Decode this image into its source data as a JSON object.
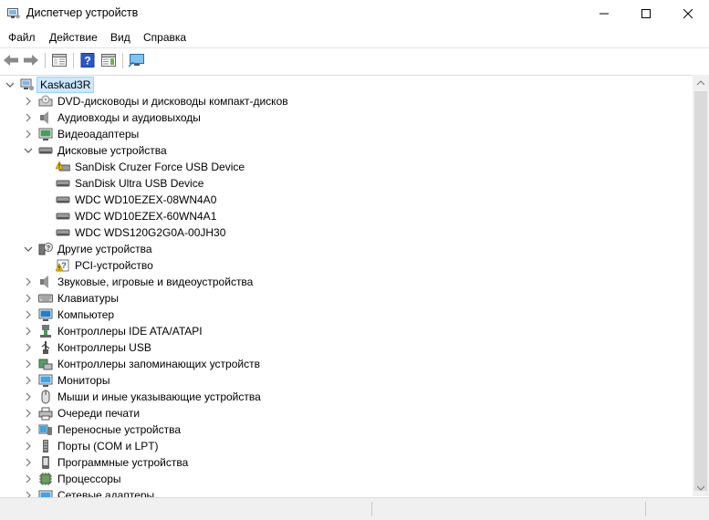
{
  "window": {
    "title": "Диспетчер устройств",
    "controls": [
      "minimize",
      "maximize",
      "close"
    ]
  },
  "menu": [
    "Файл",
    "Действие",
    "Вид",
    "Справка"
  ],
  "toolbar": [
    "back-icon",
    "forward-icon",
    "properties-panel-icon",
    "help-icon",
    "details-panel-icon",
    "monitor-scan-icon"
  ],
  "tree": {
    "root": "Kaskad3R",
    "rows": [
      {
        "label": "DVD-дисководы и дисководы компакт-дисков",
        "icon": "dvd-drive-icon"
      },
      {
        "label": "Аудиовходы и аудиовыходы",
        "icon": "speaker-icon"
      },
      {
        "label": "Видеоадаптеры",
        "icon": "display-adapter-icon"
      },
      {
        "label": "Дисковые устройства",
        "icon": "disk-drive-icon",
        "expanded": true
      },
      {
        "label": "SanDisk Cruzer Force USB Device",
        "icon": "disk-warning-icon",
        "child": true
      },
      {
        "label": "SanDisk Ultra USB Device",
        "icon": "disk-drive-icon",
        "child": true
      },
      {
        "label": "WDC WD10EZEX-08WN4A0",
        "icon": "disk-drive-icon",
        "child": true
      },
      {
        "label": "WDC WD10EZEX-60WN4A1",
        "icon": "disk-drive-icon",
        "child": true
      },
      {
        "label": "WDC WDS120G2G0A-00JH30",
        "icon": "disk-drive-icon",
        "child": true
      },
      {
        "label": "Другие устройства",
        "icon": "unknown-device-icon",
        "expanded": true
      },
      {
        "label": "PCI-устройство",
        "icon": "unknown-warning-icon",
        "child": true
      },
      {
        "label": "Звуковые, игровые и видеоустройства",
        "icon": "speaker-icon"
      },
      {
        "label": "Клавиатуры",
        "icon": "keyboard-icon"
      },
      {
        "label": "Компьютер",
        "icon": "computer-icon"
      },
      {
        "label": "Контроллеры IDE ATA/ATAPI",
        "icon": "ide-controller-icon"
      },
      {
        "label": "Контроллеры USB",
        "icon": "usb-icon"
      },
      {
        "label": "Контроллеры запоминающих устройств",
        "icon": "storage-controller-icon"
      },
      {
        "label": "Мониторы",
        "icon": "monitor-icon"
      },
      {
        "label": "Мыши и иные указывающие устройства",
        "icon": "mouse-icon"
      },
      {
        "label": "Очереди печати",
        "icon": "printer-icon"
      },
      {
        "label": "Переносные устройства",
        "icon": "portable-device-icon"
      },
      {
        "label": "Порты (COM и LPT)",
        "icon": "port-icon"
      },
      {
        "label": "Программные устройства",
        "icon": "software-device-icon"
      },
      {
        "label": "Процессоры",
        "icon": "processor-icon"
      },
      {
        "label": "Сетевые адаптеры",
        "icon": "network-adapter-icon"
      }
    ]
  },
  "colors": {
    "selection": "#cce8ff",
    "warning": "#f2c200",
    "folderBlue": "#3d8edb"
  }
}
